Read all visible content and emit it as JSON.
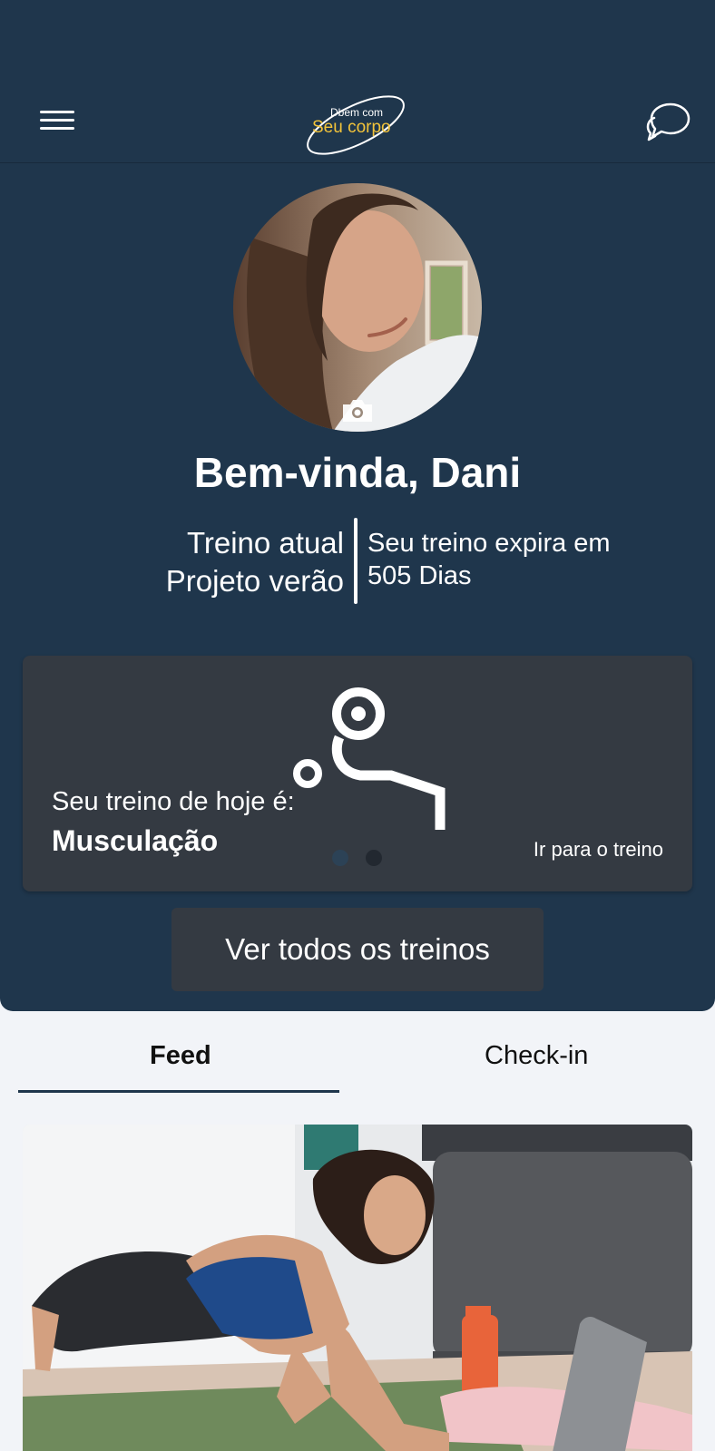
{
  "app": {
    "logo_text_small": "Dbem com",
    "logo_text_large": "Seu corpo"
  },
  "header": {
    "welcome": "Bem-vinda, Dani",
    "training_label": "Treino atual",
    "training_name": "Projeto verão",
    "expire_label": "Seu treino expira em",
    "expire_value": "505 Dias"
  },
  "today_card": {
    "subtitle": "Seu treino de hoje é:",
    "title": "Musculação",
    "link": "Ir para o treino",
    "icon": "bench-press-icon",
    "carousel_page": 1,
    "carousel_total": 2
  },
  "all_trainings_button": "Ver todos os treinos",
  "tabs": {
    "feed": "Feed",
    "checkin": "Check-in",
    "active": "Feed"
  },
  "colors": {
    "primary": "#1f364c",
    "card": "#343a42",
    "logo_accent": "#f2c33a",
    "background": "#f2f4f8"
  }
}
